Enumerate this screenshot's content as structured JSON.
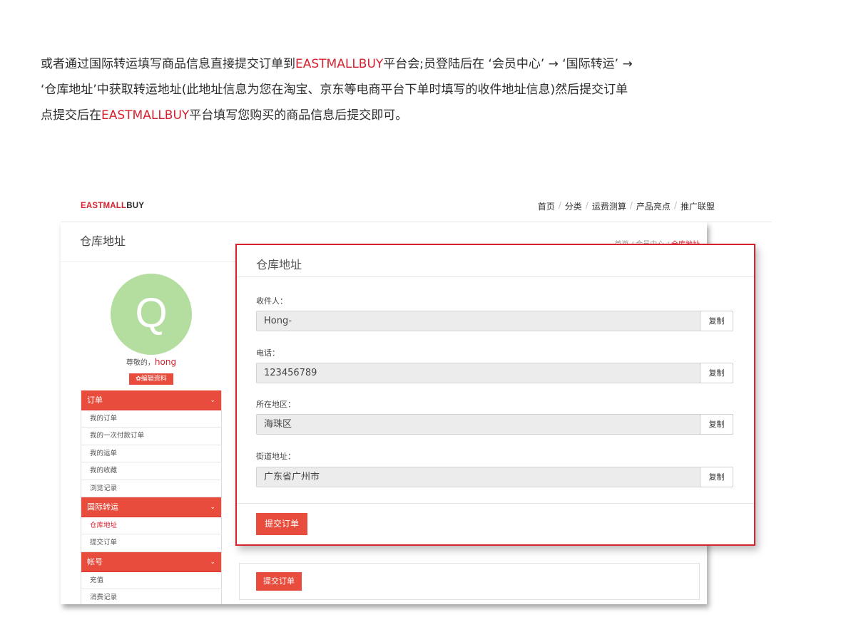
{
  "intro": {
    "seg1": "或者通过国际转运填写商品信息直接提交订单到",
    "brand1": "EASTMALLBUY",
    "seg2": "平台会;员登陆后在 ‘会员中心’ → ‘国际转运’ →",
    "seg3": "‘仓库地址’中获取转运地址(此地址信息为您在淘宝、京东等电商平台下单时填写的收件地址信息)然后提交订单",
    "seg4": "点提交后在",
    "brand2": "EASTMALLBUY",
    "seg5": "平台填写您购买的商品信息后提交即可。"
  },
  "site": {
    "logo_red": "EASTMALL",
    "logo_dark": "BUY",
    "nav": [
      "首页",
      "分类",
      "运费测算",
      "产品亮点",
      "推广联盟"
    ],
    "nav_sep": "/"
  },
  "page": {
    "title": "仓库地址",
    "breadcrumb": [
      "首页",
      "会员中心",
      "仓库地址"
    ],
    "breadcrumb_sep": "/"
  },
  "profile": {
    "avatar_letter": "Q",
    "greeting": "尊敬的，",
    "username": "hong",
    "edit_label": "✿编辑资料"
  },
  "menu": [
    {
      "label": "订单",
      "items": [
        "我的订单",
        "我的一次付款订单",
        "我的运单",
        "我的收藏",
        "浏览记录"
      ]
    },
    {
      "label": "国际转运",
      "items": [
        "仓库地址",
        "提交订单"
      ]
    },
    {
      "label": "帐号",
      "items": [
        "充值",
        "消费记录"
      ]
    }
  ],
  "modal": {
    "title": "仓库地址",
    "copy_label": "复制",
    "submit_label": "提交订单",
    "fields": [
      {
        "label": "收件人：",
        "value": "Hong-"
      },
      {
        "label": "电话：",
        "value": "123456789"
      },
      {
        "label": "所在地区：",
        "value": "海珠区"
      },
      {
        "label": "街道地址：",
        "value": "广东省广州市"
      }
    ]
  },
  "under": {
    "submit_label": "提交订单"
  }
}
